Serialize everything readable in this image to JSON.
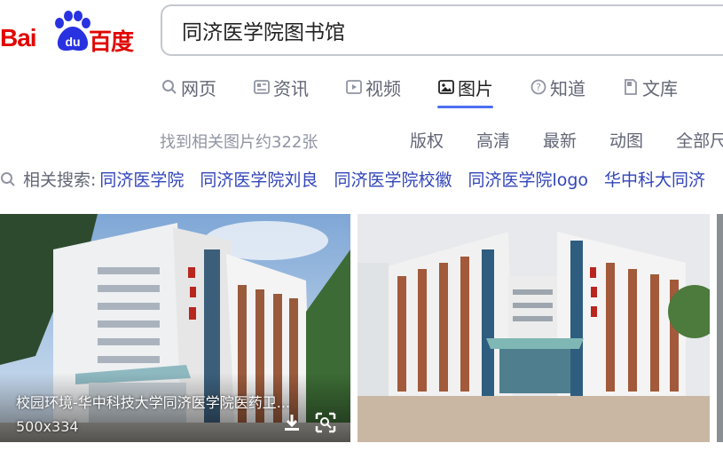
{
  "logo": {
    "bai": "Bai",
    "du": "du",
    "cn": "百度"
  },
  "search": {
    "query": "同济医学院图书馆"
  },
  "tabs": [
    {
      "label": "网页",
      "icon": "search-icon",
      "active": false
    },
    {
      "label": "资讯",
      "icon": "news-icon",
      "active": false
    },
    {
      "label": "视频",
      "icon": "video-icon",
      "active": false
    },
    {
      "label": "图片",
      "icon": "image-icon",
      "active": true
    },
    {
      "label": "知道",
      "icon": "question-icon",
      "active": false
    },
    {
      "label": "文库",
      "icon": "document-icon",
      "active": false
    }
  ],
  "results": {
    "count_text": "找到相关图片约322张"
  },
  "filters": [
    "版权",
    "高清",
    "最新",
    "动图",
    "全部尺"
  ],
  "related": {
    "label": "相关搜索:",
    "items": [
      "同济医学院",
      "同济医学院刘良",
      "同济医学院校徽",
      "同济医学院logo",
      "华中科大同济"
    ]
  },
  "images": [
    {
      "caption": "校园环境-华中科技大学同济医学院医药卫...",
      "dims": "500x334"
    },
    {
      "caption": "",
      "dims": ""
    }
  ],
  "colors": {
    "accent": "#4e6ef2",
    "brand_red": "#e10602",
    "brand_blue": "#2932e1",
    "link": "#3245b9"
  }
}
